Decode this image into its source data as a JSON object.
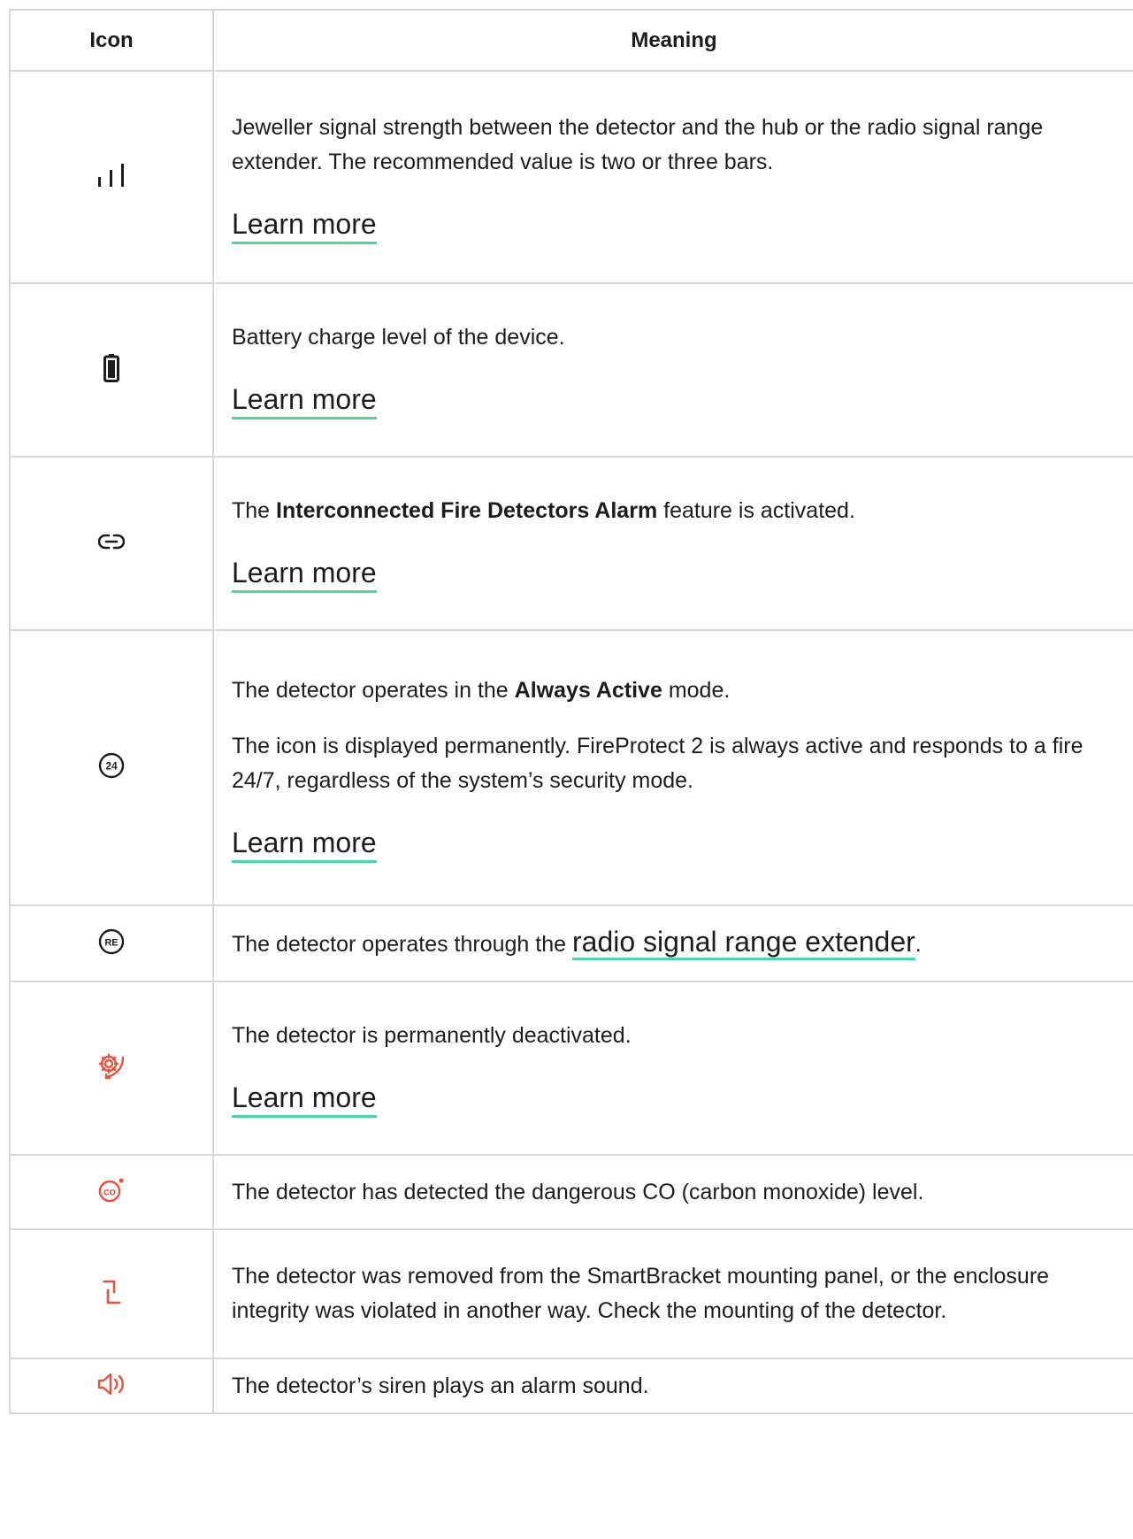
{
  "table": {
    "header": {
      "icon": "Icon",
      "meaning": "Meaning"
    },
    "rows": [
      {
        "icon": "signal-strength-icon",
        "text": "Jeweller signal strength between the detector and the hub or the radio signal range extender. The recommended value is two or three bars.",
        "link": "Learn more"
      },
      {
        "icon": "battery-icon",
        "text": "Battery charge level of the device.",
        "link": "Learn more"
      },
      {
        "icon": "link-icon",
        "pre": "The ",
        "bold": "Interconnected Fire Detectors Alarm",
        "post": " feature is activated.",
        "link": "Learn more"
      },
      {
        "icon": "always-active-24-icon",
        "pre": "The detector operates in the ",
        "bold": "Always Active",
        "post": " mode.",
        "text2": "The icon is displayed permanently. FireProtect 2 is always active and responds to a fire 24/7, regardless of the system’s security mode.",
        "link": "Learn more"
      },
      {
        "icon": "range-extender-re-icon",
        "pre": "The detector operates through the ",
        "link": "radio signal range extender",
        "post": "."
      },
      {
        "icon": "deactivated-gear-icon",
        "text": "The detector is permanently deactivated.",
        "link": "Learn more"
      },
      {
        "icon": "co-alarm-icon",
        "text": "The detector has detected the dangerous CO (carbon monoxide) level."
      },
      {
        "icon": "tamper-icon",
        "text": "The detector was removed from the SmartBracket mounting panel, or the enclosure integrity was violated in another way. Check the mounting of the detector."
      },
      {
        "icon": "siren-speaker-icon",
        "text": "The detector’s siren plays an alarm sound."
      }
    ]
  },
  "colors": {
    "alert_red": "#e8533f",
    "link_underline": "#4fd6a1",
    "border": "#d9d9d9"
  }
}
